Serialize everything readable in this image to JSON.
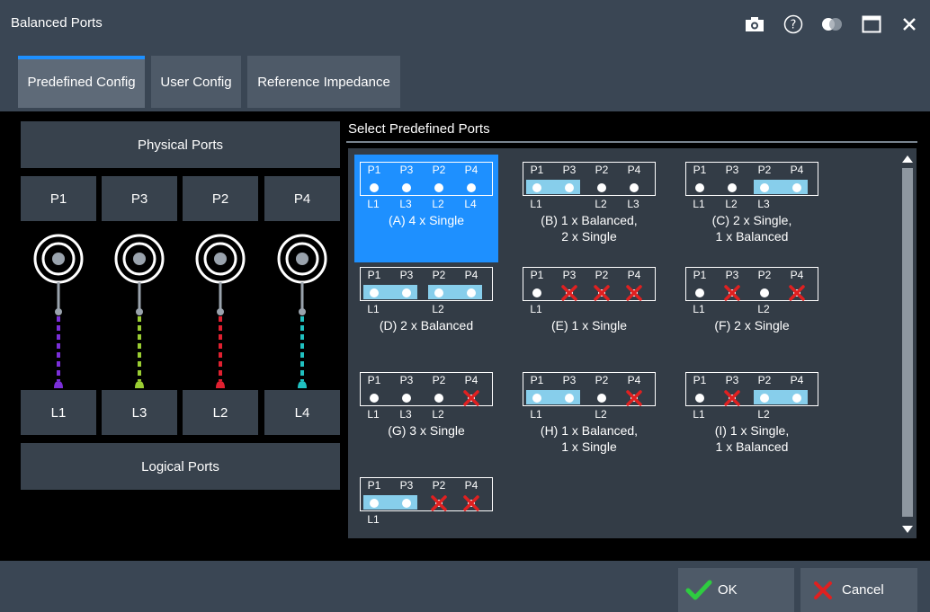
{
  "window": {
    "title": "Balanced Ports"
  },
  "titlebar_icons": [
    "camera-icon",
    "help-icon",
    "toggle-icon",
    "maximize-icon",
    "close-icon"
  ],
  "tabs": [
    {
      "label": "Predefined Config",
      "active": true
    },
    {
      "label": "User Config",
      "active": false
    },
    {
      "label": "Reference Impedance",
      "active": false
    }
  ],
  "left": {
    "physical_label": "Physical Ports",
    "logical_label": "Logical Ports",
    "physical": [
      "P1",
      "P3",
      "P2",
      "P4"
    ],
    "logical": [
      "L1",
      "L3",
      "L2",
      "L4"
    ],
    "colors": [
      "#7b2fd9",
      "#9acd32",
      "#e02030",
      "#20c0c0"
    ]
  },
  "section_title": "Select Predefined Ports",
  "port_header": [
    "P1",
    "P3",
    "P2",
    "P4"
  ],
  "options": [
    {
      "caption1": "(A) 4 x Single",
      "caption2": "",
      "selected": true,
      "slots": [
        "dot",
        "dot",
        "dot",
        "dot"
      ],
      "balanced": [],
      "llabels": [
        "L1",
        "L3",
        "L2",
        "L4"
      ]
    },
    {
      "caption1": "(B) 1 x Balanced,",
      "caption2": "2 x Single",
      "selected": false,
      "slots": [
        "dot",
        "dot",
        "dot",
        "dot"
      ],
      "balanced": [
        [
          0,
          1
        ]
      ],
      "llabels": [
        "L1",
        "",
        "L2",
        "L3"
      ]
    },
    {
      "caption1": "(C) 2 x Single,",
      "caption2": "1 x Balanced",
      "selected": false,
      "slots": [
        "dot",
        "dot",
        "dot",
        "dot"
      ],
      "balanced": [
        [
          2,
          3
        ]
      ],
      "llabels": [
        "L1",
        "L2",
        "L3",
        ""
      ]
    },
    {
      "caption1": "(D) 2 x Balanced",
      "caption2": "",
      "selected": false,
      "slots": [
        "dot",
        "dot",
        "dot",
        "dot"
      ],
      "balanced": [
        [
          0,
          1
        ],
        [
          2,
          3
        ]
      ],
      "llabels": [
        "L1",
        "",
        "L2",
        ""
      ]
    },
    {
      "caption1": "(E) 1 x Single",
      "caption2": "",
      "selected": false,
      "slots": [
        "dot",
        "x",
        "x",
        "x"
      ],
      "balanced": [],
      "llabels": [
        "L1",
        "",
        "",
        ""
      ]
    },
    {
      "caption1": "(F) 2 x Single",
      "caption2": "",
      "selected": false,
      "slots": [
        "dot",
        "x",
        "dot",
        "x"
      ],
      "balanced": [],
      "llabels": [
        "L1",
        "",
        "L2",
        ""
      ]
    },
    {
      "caption1": "(G) 3 x Single",
      "caption2": "",
      "selected": false,
      "slots": [
        "dot",
        "dot",
        "dot",
        "x"
      ],
      "balanced": [],
      "llabels": [
        "L1",
        "L3",
        "L2",
        ""
      ]
    },
    {
      "caption1": "(H) 1 x Balanced,",
      "caption2": "1 x Single",
      "selected": false,
      "slots": [
        "dot",
        "dot",
        "dot",
        "x"
      ],
      "balanced": [
        [
          0,
          1
        ]
      ],
      "llabels": [
        "L1",
        "",
        "L2",
        ""
      ]
    },
    {
      "caption1": "(I) 1 x Single,",
      "caption2": "1 x Balanced",
      "selected": false,
      "slots": [
        "dot",
        "x",
        "dot",
        "dot"
      ],
      "balanced": [
        [
          2,
          3
        ]
      ],
      "llabels": [
        "L1",
        "",
        "L2",
        ""
      ]
    },
    {
      "caption1": "",
      "caption2": "",
      "selected": false,
      "slots": [
        "dot",
        "dot",
        "x",
        "x"
      ],
      "balanced": [
        [
          0,
          1
        ]
      ],
      "llabels": [
        "L1",
        "",
        "",
        ""
      ]
    }
  ],
  "footer": {
    "ok_label": "OK",
    "cancel_label": "Cancel"
  }
}
